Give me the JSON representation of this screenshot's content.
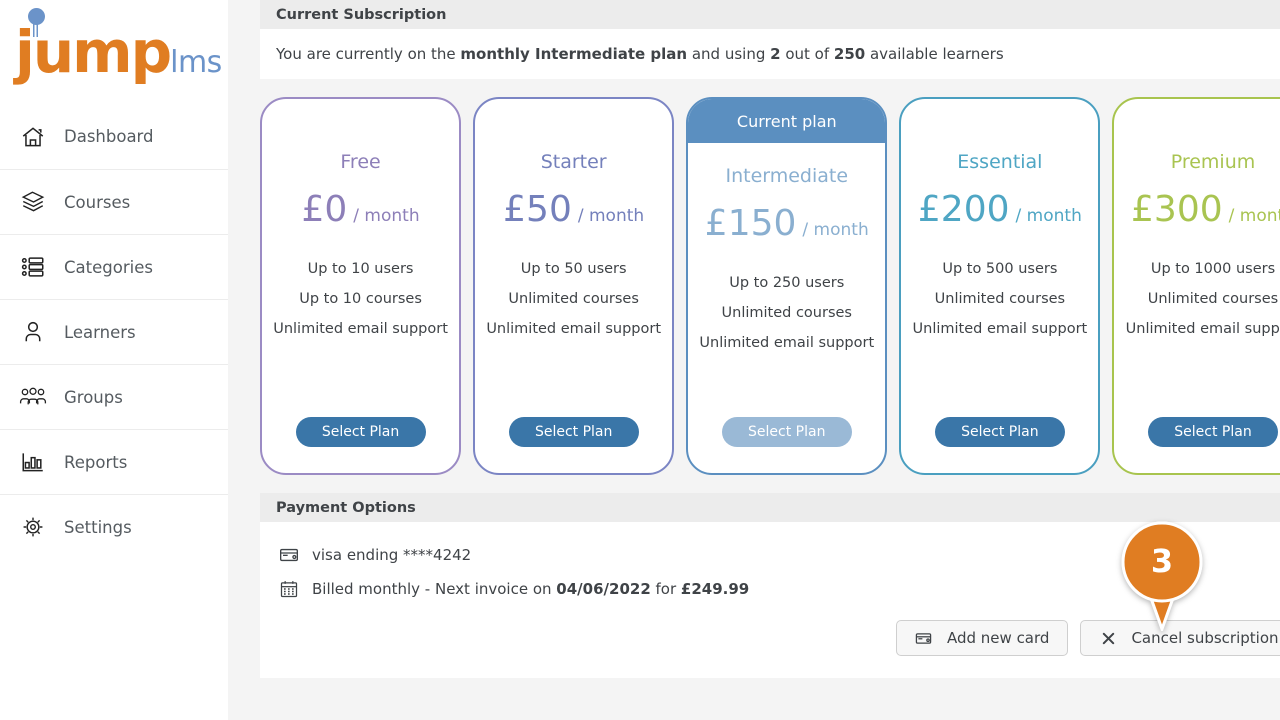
{
  "brand": {
    "name_primary": "jump",
    "name_secondary": "lms"
  },
  "sidebar": {
    "items": [
      {
        "label": "Dashboard",
        "icon": "home-icon"
      },
      {
        "label": "Courses",
        "icon": "books-stack-icon"
      },
      {
        "label": "Categories",
        "icon": "list-icon"
      },
      {
        "label": "Learners",
        "icon": "user-icon"
      },
      {
        "label": "Groups",
        "icon": "users-group-icon"
      },
      {
        "label": "Reports",
        "icon": "bar-chart-icon"
      },
      {
        "label": "Settings",
        "icon": "gear-icon"
      }
    ]
  },
  "subscription": {
    "panel_title": "Current Subscription",
    "summary_prefix": "You are currently on the ",
    "summary_plan": "monthly Intermediate plan",
    "summary_mid": " and using ",
    "summary_used": "2",
    "summary_of": " out of ",
    "summary_total": "250",
    "summary_suffix": " available learners"
  },
  "plans": {
    "select_label": "Select Plan",
    "current_ribbon": "Current plan",
    "items": [
      {
        "name": "Free",
        "price": "£0",
        "per": "/ month",
        "features": [
          "Up to 10 users",
          "Up to 10 courses",
          "Unlimited email support"
        ],
        "border_color": "#9b8bc4",
        "accent_color": "#8d7fb8",
        "button_color": "#3a76a8",
        "is_current": false,
        "button_disabled": false
      },
      {
        "name": "Starter",
        "price": "£50",
        "per": "/ month",
        "features": [
          "Up to 50 users",
          "Unlimited courses",
          "Unlimited email support"
        ],
        "border_color": "#7b85c4",
        "accent_color": "#7480bb",
        "button_color": "#3a76a8",
        "is_current": false,
        "button_disabled": false
      },
      {
        "name": "Intermediate",
        "price": "£150",
        "per": "/ month",
        "features": [
          "Up to 250 users",
          "Unlimited courses",
          "Unlimited email support"
        ],
        "border_color": "#5b8fc0",
        "accent_color": "#8aafd0",
        "button_color": "#9ab9d6",
        "is_current": true,
        "button_disabled": true
      },
      {
        "name": "Essential",
        "price": "£200",
        "per": "/ month",
        "features": [
          "Up to 500 users",
          "Unlimited courses",
          "Unlimited email support"
        ],
        "border_color": "#4a9fc0",
        "accent_color": "#4fa6c4",
        "button_color": "#3a76a8",
        "is_current": false,
        "button_disabled": false
      },
      {
        "name": "Premium",
        "price": "£300",
        "per": "/ month",
        "features": [
          "Up to 1000 users",
          "Unlimited courses",
          "Unlimited email support"
        ],
        "border_color": "#a8c44e",
        "accent_color": "#a9c451",
        "button_color": "#3a76a8",
        "is_current": false,
        "button_disabled": false
      }
    ]
  },
  "payment": {
    "panel_title": "Payment Options",
    "card_line": "visa ending ****4242",
    "billing_prefix": "Billed monthly - Next invoice on ",
    "billing_date": "04/06/2022",
    "billing_mid": " for ",
    "billing_amount": "£249.99",
    "add_card_label": "Add new card",
    "cancel_label": "Cancel subscription"
  },
  "marker": {
    "number": "3",
    "color": "#e07d22"
  }
}
